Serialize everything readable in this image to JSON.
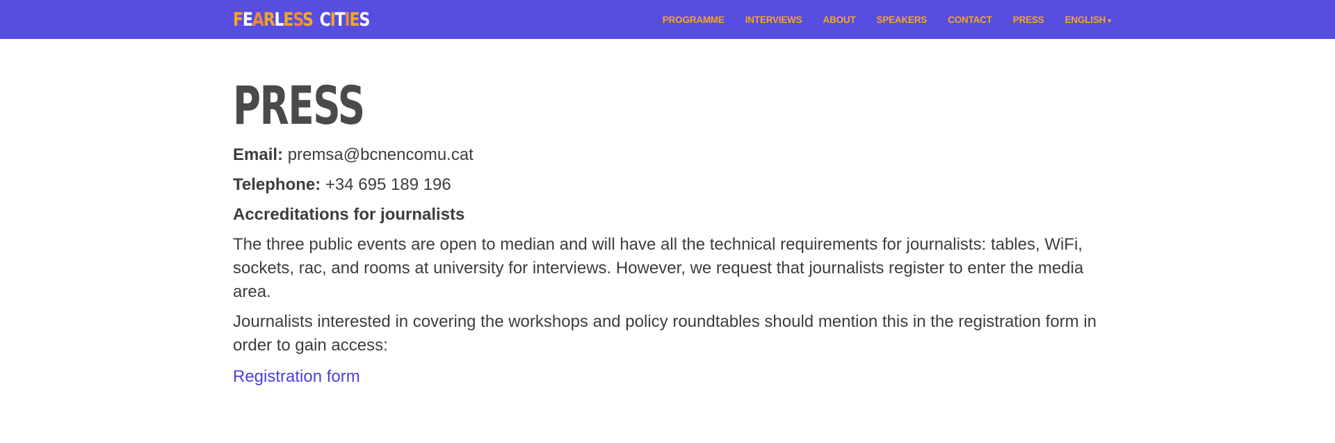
{
  "header": {
    "logo": {
      "letters": [
        {
          "ch": "F",
          "color": "#f5a623"
        },
        {
          "ch": "E",
          "color": "#ffffff"
        },
        {
          "ch": "A",
          "color": "#f08a3c"
        },
        {
          "ch": "R",
          "color": "#f5a623"
        },
        {
          "ch": "L",
          "color": "#ffffff"
        },
        {
          "ch": "E",
          "color": "#f5a623"
        },
        {
          "ch": "S",
          "color": "#f08a3c"
        },
        {
          "ch": "S",
          "color": "#f5a623"
        },
        {
          "ch": "C",
          "color": "#ffffff"
        },
        {
          "ch": "I",
          "color": "#f5a623"
        },
        {
          "ch": "T",
          "color": "#ffffff"
        },
        {
          "ch": "I",
          "color": "#f08a3c"
        },
        {
          "ch": "E",
          "color": "#f5a623"
        },
        {
          "ch": "S",
          "color": "#ffffff"
        }
      ]
    },
    "nav": {
      "programme": "PROGRAMME",
      "interviews": "INTERVIEWS",
      "about": "ABOUT",
      "speakers": "SPEAKERS",
      "contact": "CONTACT",
      "press": "PRESS",
      "language": "ENGLISH",
      "language_caret": "▾"
    },
    "colors": {
      "bar": "#574de0",
      "nav_text": "#f5a623"
    }
  },
  "main": {
    "title": "PRESS",
    "email_label": "Email:",
    "email_value": " premsa@bcnencomu.cat",
    "telephone_label": "Telephone:",
    "telephone_value": " +34 695 189 196",
    "accreditations_heading": "Accreditations for journalists",
    "paragraph1": "The three public events are open to median and will have all the technical requirements for journalists: tables, WiFi, sockets, rac, and rooms at university for interviews. However, we request that journalists register to enter the media area.",
    "paragraph2": "Journalists interested in covering the workshops and policy roundtables should mention this in the registration form in order to gain access:",
    "registration_link": "Registration form",
    "link_color": "#4a3fe0"
  }
}
